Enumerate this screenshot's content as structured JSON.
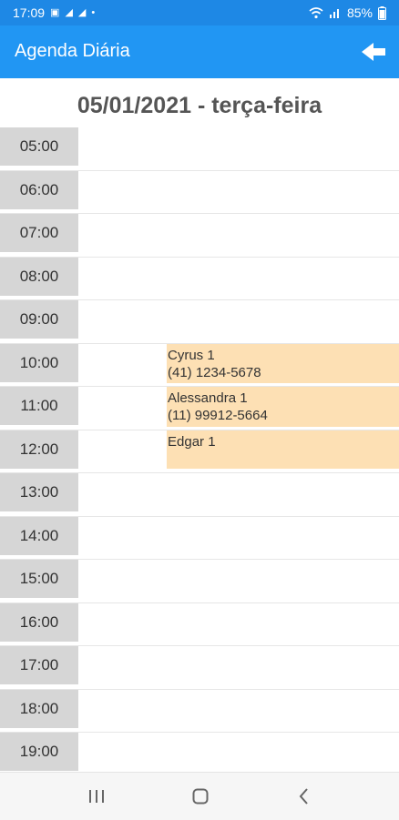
{
  "status_bar": {
    "time": "17:09",
    "battery": "85%",
    "notification_icons": [
      "image-icon",
      "notification-icon",
      "notification-icon",
      "dot-icon"
    ],
    "system_icons": [
      "wifi-icon",
      "signal-icon",
      "battery-icon"
    ]
  },
  "app_bar": {
    "title": "Agenda Diária",
    "back_icon": "arrow-left-icon"
  },
  "date_header": "05/01/2021 - terça-feira",
  "time_slots": [
    "05:00",
    "06:00",
    "07:00",
    "08:00",
    "09:00",
    "10:00",
    "11:00",
    "12:00",
    "13:00",
    "14:00",
    "15:00",
    "16:00",
    "17:00",
    "18:00",
    "19:00"
  ],
  "appointments": [
    {
      "slot": "10:00",
      "name": "Cyrus 1",
      "phone": "(41) 1234-5678"
    },
    {
      "slot": "11:00",
      "name": "Alessandra 1",
      "phone": "(11) 99912-5664"
    },
    {
      "slot": "12:00",
      "name": "Edgar 1",
      "phone": ""
    }
  ],
  "colors": {
    "app_bar": "#2196f3",
    "status_bar": "#1e88e5",
    "appointment": "#fde0b4",
    "time_cell": "#d6d6d6"
  },
  "nav_bar": {
    "buttons": [
      "recent-apps-icon",
      "home-icon",
      "back-icon"
    ]
  }
}
